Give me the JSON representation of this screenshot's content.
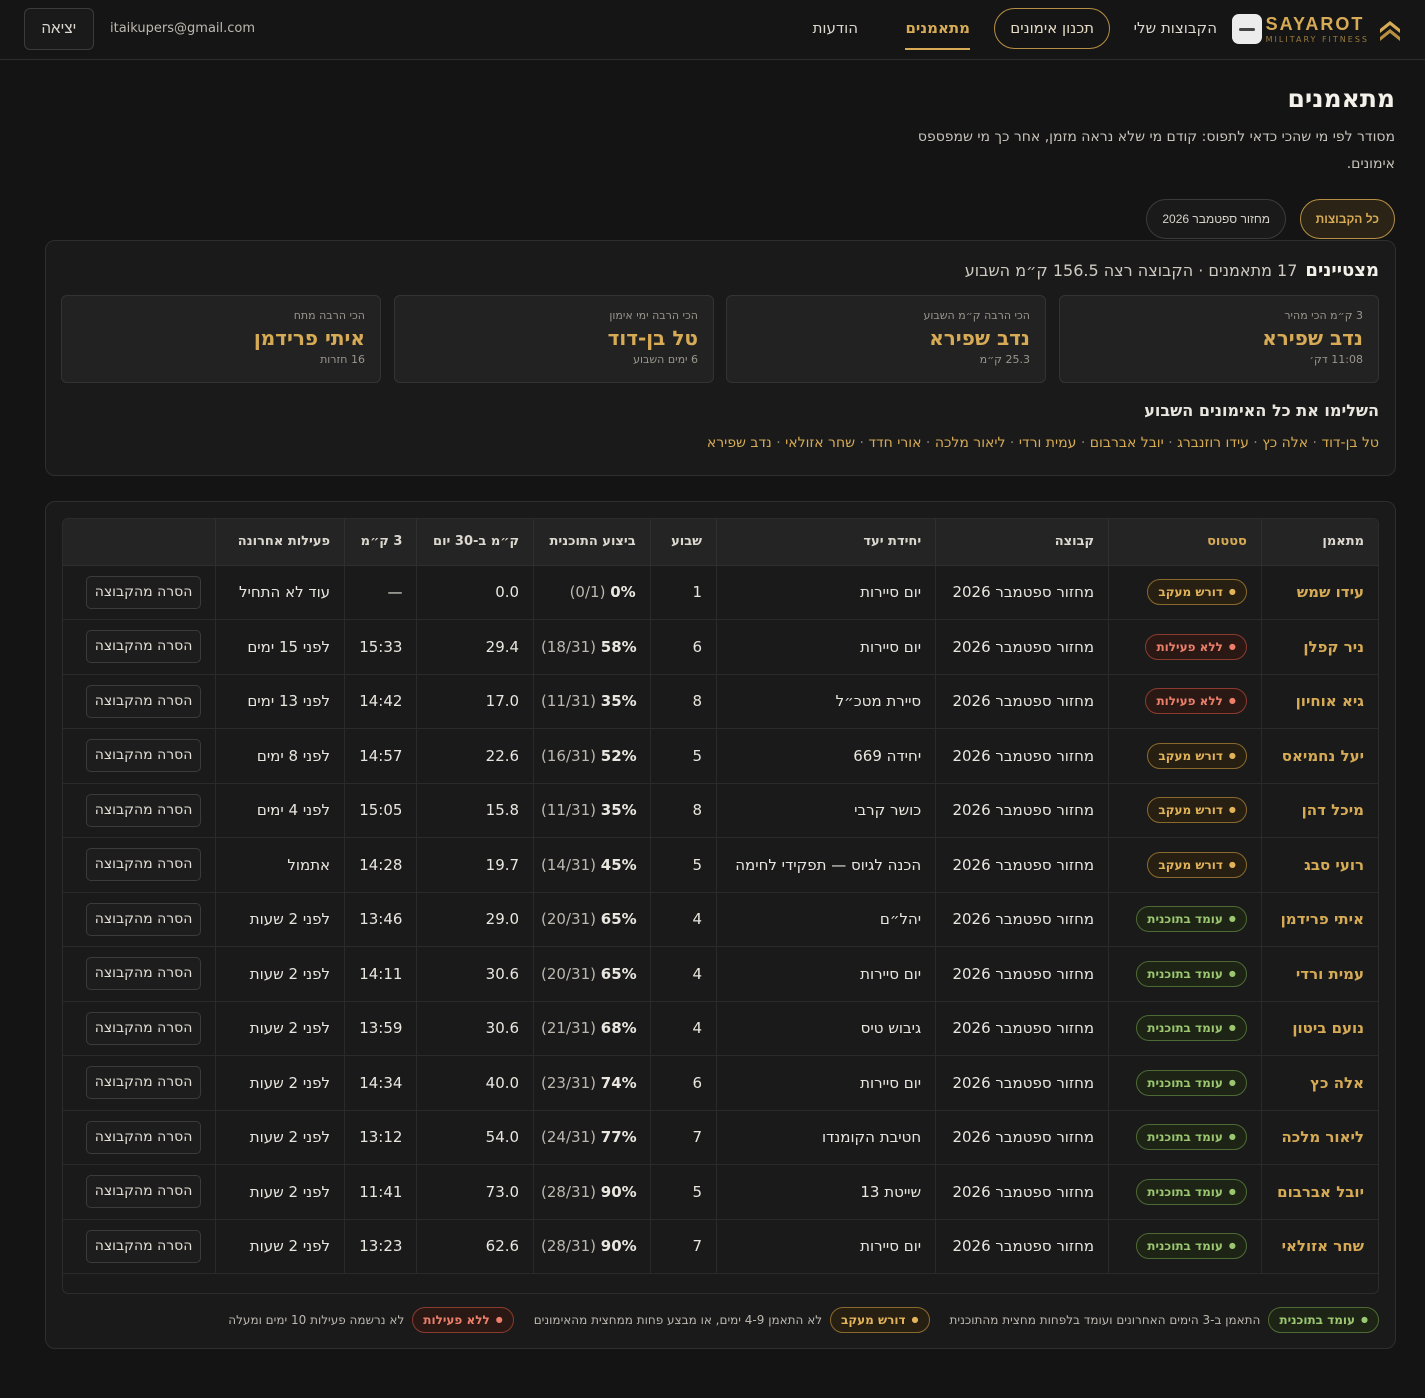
{
  "nav": {
    "brand_name": "SAYAROT",
    "brand_sub": "MILITARY FITNESS",
    "my_groups": "הקבוצות שלי",
    "training_plan": "תכנון אימונים",
    "trainees": "מתאמנים",
    "messages": "הודעות",
    "user_email": "itaikupers@gmail.com",
    "logout": "יציאה"
  },
  "page": {
    "title": "מתאמנים",
    "subtitle": "מסודר לפי מי שהכי כדאי לתפוס: קודם מי שלא נראה מזמן, אחר כך מי שמפספס אימונים."
  },
  "filters": {
    "all_groups": "כל הקבוצות",
    "cycle": "מחזור ספטמבר 2026"
  },
  "highlights": {
    "title": "מצטיינים",
    "summary": "17 מתאמנים · הקבוצה רצה 156.5 ק״מ השבוע",
    "stats": [
      {
        "label": "3 ק״מ הכי מהיר",
        "name": "נדב שפירא",
        "value": "11:08 דק׳"
      },
      {
        "label": "הכי הרבה ק״מ השבוע",
        "name": "נדב שפירא",
        "value": "25.3 ק״מ"
      },
      {
        "label": "הכי הרבה ימי אימון",
        "name": "טל בן-דוד",
        "value": "6 ימים השבוע"
      },
      {
        "label": "הכי הרבה מתח",
        "name": "איתי פרידמן",
        "value": "16 חזרות"
      }
    ],
    "completed_title": "השלימו את כל האימונים השבוע",
    "completed": [
      "טל בן-דוד",
      "אלה כץ",
      "עידו רוזנברג",
      "יובל אברבום",
      "עמית ורדי",
      "ליאור מלכה",
      "אורי חדד",
      "שחר אזולאי",
      "נדב שפירא"
    ]
  },
  "table": {
    "columns": {
      "trainee": "מתאמן",
      "status": "סטטוס",
      "group": "קבוצה",
      "target_unit": "יחידת יעד",
      "week": "שבוע",
      "plan_execution": "ביצוע התוכנית",
      "km_30": "ק״מ ב-30 יום",
      "km3": "3 ק״מ",
      "last_activity": "פעילות אחרונה"
    },
    "remove_label": "הסרה מהקבוצה",
    "status_labels": {
      "track": "עומד בתוכנית",
      "follow": "דורש מעקב",
      "idle": "ללא פעילות"
    },
    "rows": [
      {
        "name": "עידו שמש",
        "status": "follow",
        "group": "מחזור ספטמבר 2026",
        "unit": "יום סיירות",
        "week": "1",
        "pct": "0%",
        "frac": "(0/1)",
        "km30": "0.0",
        "km3": "—",
        "last": "עוד לא התחיל"
      },
      {
        "name": "ניר קפלן",
        "status": "idle",
        "group": "מחזור ספטמבר 2026",
        "unit": "יום סיירות",
        "week": "6",
        "pct": "58%",
        "frac": "(18/31)",
        "km30": "29.4",
        "km3": "15:33",
        "last": "לפני 15 ימים"
      },
      {
        "name": "גיא אוחיון",
        "status": "idle",
        "group": "מחזור ספטמבר 2026",
        "unit": "סיירת מטכ״ל",
        "week": "8",
        "pct": "35%",
        "frac": "(11/31)",
        "km30": "17.0",
        "km3": "14:42",
        "last": "לפני 13 ימים"
      },
      {
        "name": "יעל נחמיאס",
        "status": "follow",
        "group": "מחזור ספטמבר 2026",
        "unit": "יחידה 669",
        "week": "5",
        "pct": "52%",
        "frac": "(16/31)",
        "km30": "22.6",
        "km3": "14:57",
        "last": "לפני 8 ימים"
      },
      {
        "name": "מיכל דהן",
        "status": "follow",
        "group": "מחזור ספטמבר 2026",
        "unit": "כושר קרבי",
        "week": "8",
        "pct": "35%",
        "frac": "(11/31)",
        "km30": "15.8",
        "km3": "15:05",
        "last": "לפני 4 ימים"
      },
      {
        "name": "רועי סבג",
        "status": "follow",
        "group": "מחזור ספטמבר 2026",
        "unit": "הכנה לגיוס — תפקידי לחימה",
        "week": "5",
        "pct": "45%",
        "frac": "(14/31)",
        "km30": "19.7",
        "km3": "14:28",
        "last": "אתמול"
      },
      {
        "name": "איתי פרידמן",
        "status": "track",
        "group": "מחזור ספטמבר 2026",
        "unit": "יהל״ם",
        "week": "4",
        "pct": "65%",
        "frac": "(20/31)",
        "km30": "29.0",
        "km3": "13:46",
        "last": "לפני 2 שעות"
      },
      {
        "name": "עמית ורדי",
        "status": "track",
        "group": "מחזור ספטמבר 2026",
        "unit": "יום סיירות",
        "week": "4",
        "pct": "65%",
        "frac": "(20/31)",
        "km30": "30.6",
        "km3": "14:11",
        "last": "לפני 2 שעות"
      },
      {
        "name": "נועם ביטון",
        "status": "track",
        "group": "מחזור ספטמבר 2026",
        "unit": "גיבוש טיס",
        "week": "4",
        "pct": "68%",
        "frac": "(21/31)",
        "km30": "30.6",
        "km3": "13:59",
        "last": "לפני 2 שעות"
      },
      {
        "name": "אלה כץ",
        "status": "track",
        "group": "מחזור ספטמבר 2026",
        "unit": "יום סיירות",
        "week": "6",
        "pct": "74%",
        "frac": "(23/31)",
        "km30": "40.0",
        "km3": "14:34",
        "last": "לפני 2 שעות"
      },
      {
        "name": "ליאור מלכה",
        "status": "track",
        "group": "מחזור ספטמבר 2026",
        "unit": "חטיבת הקומנדו",
        "week": "7",
        "pct": "77%",
        "frac": "(24/31)",
        "km30": "54.0",
        "km3": "13:12",
        "last": "לפני 2 שעות"
      },
      {
        "name": "יובל אברבום",
        "status": "track",
        "group": "מחזור ספטמבר 2026",
        "unit": "שייטת 13",
        "week": "5",
        "pct": "90%",
        "frac": "(28/31)",
        "km30": "73.0",
        "km3": "11:41",
        "last": "לפני 2 שעות"
      },
      {
        "name": "שחר אזולאי",
        "status": "track",
        "group": "מחזור ספטמבר 2026",
        "unit": "יום סיירות",
        "week": "7",
        "pct": "90%",
        "frac": "(28/31)",
        "km30": "62.6",
        "km3": "13:23",
        "last": "לפני 2 שעות"
      }
    ]
  },
  "legend": [
    {
      "status": "track",
      "label": "עומד בתוכנית",
      "desc": "התאמן ב-3 הימים האחרונים ועומד בלפחות מחצית מהתוכנית"
    },
    {
      "status": "follow",
      "label": "דורש מעקב",
      "desc": "לא התאמן 4-9 ימים, או מבצע פחות ממחצית מהאימונים"
    },
    {
      "status": "idle",
      "label": "ללא פעילות",
      "desc": "לא נרשמה פעילות 10 ימים ומעלה"
    }
  ]
}
